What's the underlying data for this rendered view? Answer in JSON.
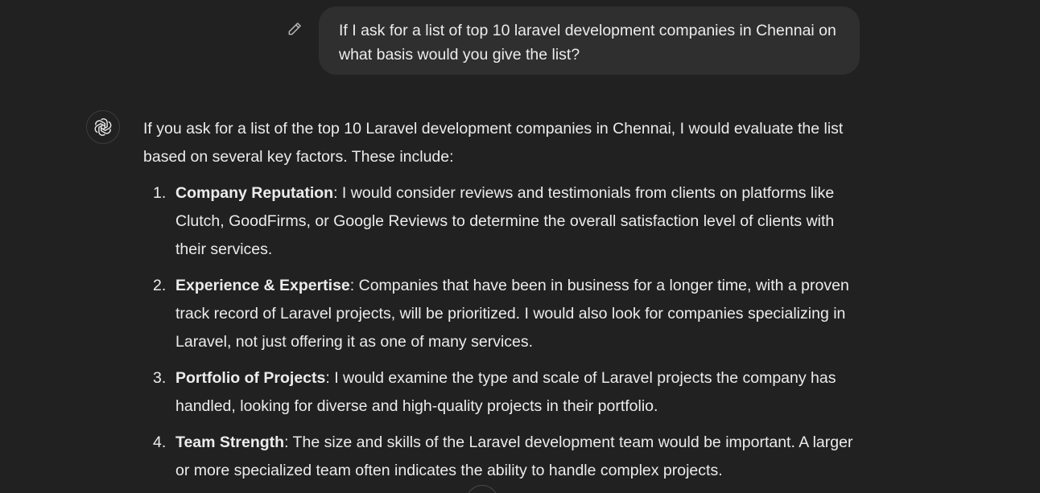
{
  "user_message": {
    "text": "If I ask for a list of top 10 laravel development companies in Chennai on what basis would you give the list?",
    "edit_icon": "pencil-icon"
  },
  "assistant": {
    "avatar_icon": "openai-logo-icon",
    "intro": "If you ask for a list of the top 10 Laravel development companies in Chennai, I would evaluate the list based on several key factors. These include:",
    "items": [
      {
        "number": "1.",
        "title": "Company Reputation",
        "text": ": I would consider reviews and testimonials from clients on platforms like Clutch, GoodFirms, or Google Reviews to determine the overall satisfaction level of clients with their services."
      },
      {
        "number": "2.",
        "title": "Experience & Expertise",
        "text": ": Companies that have been in business for a longer time, with a proven track record of Laravel projects, will be prioritized. I would also look for companies specializing in Laravel, not just offering it as one of many services."
      },
      {
        "number": "3.",
        "title": "Portfolio of Projects",
        "text": ": I would examine the type and scale of Laravel projects the company has handled, looking for diverse and high-quality projects in their portfolio."
      },
      {
        "number": "4.",
        "title": "Team Strength",
        "text": ": The size and skills of the Laravel development team would be important. A larger or more specialized team often indicates the ability to handle complex projects."
      }
    ]
  },
  "colors": {
    "background": "#212121",
    "bubble": "#2f2f2f",
    "text": "#ececec"
  }
}
